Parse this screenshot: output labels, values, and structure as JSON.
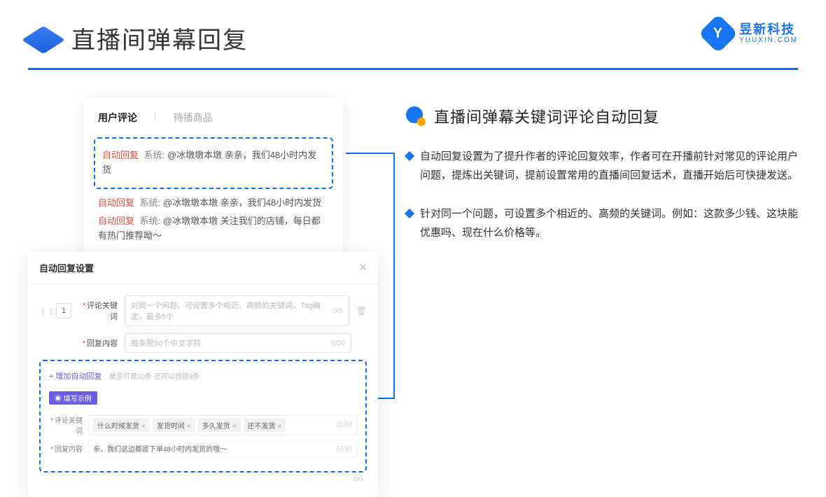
{
  "header": {
    "title": "直播间弹幕回复",
    "brand_cn": "昱新科技",
    "brand_en": "YUUXIN.COM",
    "brand_letter": "Y"
  },
  "comments_card": {
    "tab_active": "用户评论",
    "tab_inactive": "待播商品",
    "auto_tag": "自动回复",
    "sys_prefix": "系统:",
    "c1": "@冰墩墩本墩 亲亲，我们48小时内发货",
    "c2": "@冰墩墩本墩 亲亲，我们48小时内发货",
    "c3": "@冰墩墩本墩 关注我们的店铺，每日都有热门推荐呦～"
  },
  "settings_card": {
    "title": "自动回复设置",
    "idx": "1",
    "label_keyword": "评论关键词",
    "label_content": "回复内容",
    "placeholder_keyword": "对同一个问题，可设置多个相近、高频的关键词，Tag确定，最多5个",
    "placeholder_content": "每条限50个中文字符",
    "cnt_kw": "0/5",
    "cnt_ct": "0/50",
    "add_link": "+ 增加自动回复",
    "add_hint": "最多可建10条 还可以创建9条",
    "example_badge": "◉ 填写示例",
    "ex_label_kw": "评论关键词",
    "ex_label_ct": "回复内容",
    "ex_tags": [
      "什么时候发货",
      "发货时间",
      "多久发货",
      "还不发货"
    ],
    "ex_cnt_kw": "20/50",
    "ex_content": "亲，我们这边都是下单48小时内发货的哦～",
    "ex_cnt_ct": "37/50",
    "outer_cnt": "/50"
  },
  "right": {
    "section_title": "直播间弹幕关键词评论自动回复",
    "p1": "自动回复设置为了提升作者的评论回复效率，作者可在开播前针对常见的评论用户问题，提炼出关键词，提前设置常用的直播间回复话术，直播开始后可快捷发送。",
    "p2": "针对同一个问题，可设置多个相近的、高频的关键词。例如：这款多少钱、这块能优惠吗、现在什么价格等。"
  }
}
